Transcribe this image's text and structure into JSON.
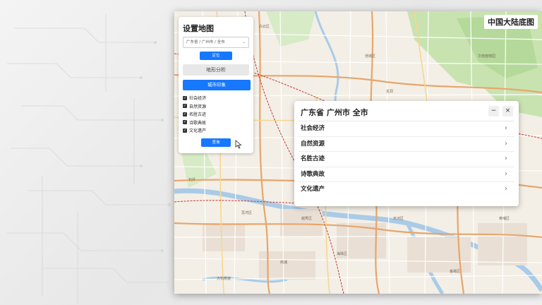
{
  "map": {
    "base_title": "中国大陆底图",
    "labels": [
      "广州市",
      "天河区",
      "越秀区",
      "海珠区",
      "番禺区",
      "黄埔区",
      "白云区",
      "荔湾区",
      "石井",
      "新塘镇",
      "龙洞",
      "华南植物园",
      "增城区",
      "南浦",
      "大石街道"
    ]
  },
  "panel": {
    "title": "设置地图",
    "region": "广东省 / 广州市 / 全市",
    "locate_label": "定位",
    "terrain_label": "地形分析",
    "city_label": "城市印象",
    "checkboxes": [
      {
        "label": "社会经济",
        "checked": true
      },
      {
        "label": "自然资源",
        "checked": true
      },
      {
        "label": "名胜古迹",
        "checked": true
      },
      {
        "label": "诗歌典故",
        "checked": true
      },
      {
        "label": "文化遗产",
        "checked": true
      }
    ],
    "query_label": "查询"
  },
  "card": {
    "title": "广东省 广州市 全市",
    "minimize": "−",
    "close": "×",
    "rows": [
      "社会经济",
      "自然资源",
      "名胜古迹",
      "诗歌典故",
      "文化遗产"
    ]
  },
  "colors": {
    "accent": "#1677ff",
    "map_background": "#f3efe6",
    "water": "#a9cbe8",
    "green": "#c8e3b0",
    "main_road": "#e8a56a",
    "rail": "#c23b3b"
  }
}
